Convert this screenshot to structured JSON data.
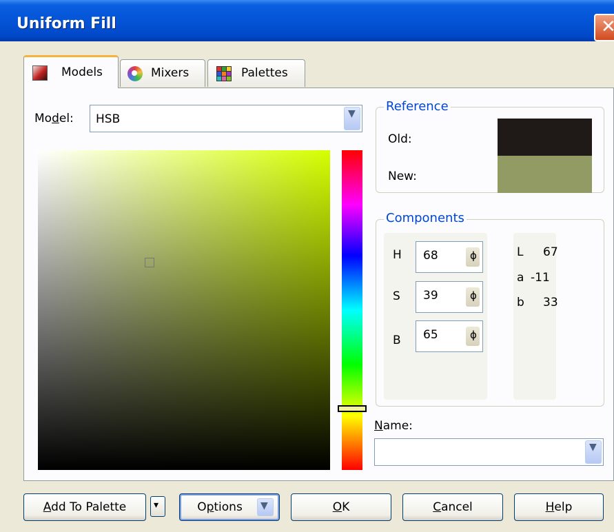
{
  "window": {
    "title": "Uniform Fill",
    "close_glyph": "✕"
  },
  "tabs": [
    {
      "label": "Models",
      "icon": "models-icon",
      "active": true
    },
    {
      "label": "Mixers",
      "icon": "mixers-icon",
      "active": false
    },
    {
      "label": "Palettes",
      "icon": "palettes-icon",
      "active": false
    }
  ],
  "model": {
    "label_pre": "Mo",
    "label_ul": "d",
    "label_post": "el:",
    "value": "HSB"
  },
  "reference": {
    "title": "Reference",
    "old_label": "Old:",
    "old_color": "#1f1a17",
    "new_label": "New:",
    "new_color": "#939b64"
  },
  "components": {
    "title": "Components",
    "hsb": [
      {
        "label": "H",
        "value": "68"
      },
      {
        "label": "S",
        "value": "39"
      },
      {
        "label": "B",
        "value": "65"
      }
    ],
    "lab": [
      {
        "label": "L",
        "value": "67"
      },
      {
        "label": "a",
        "value": "-11"
      },
      {
        "label": "b",
        "value": "33"
      }
    ]
  },
  "name": {
    "label_ul": "N",
    "label_post": "ame:",
    "value": ""
  },
  "picker": {
    "hue_deg": 68,
    "saturation_pct": 39,
    "brightness_pct": 65,
    "pure_hue_color": "#d5ff00"
  },
  "buttons": {
    "add_to_palette": {
      "ul": "A",
      "rest": "dd To Palette"
    },
    "options": {
      "pre": "O",
      "ul": "p",
      "rest": "tions"
    },
    "ok": {
      "ul": "O",
      "rest": "K"
    },
    "cancel": {
      "ul": "C",
      "rest": "ancel"
    },
    "help": {
      "ul": "H",
      "rest": "elp"
    }
  },
  "glyphs": {
    "dropdown": "▼",
    "spin": "ɸ",
    "small_dropdown": "▾"
  }
}
